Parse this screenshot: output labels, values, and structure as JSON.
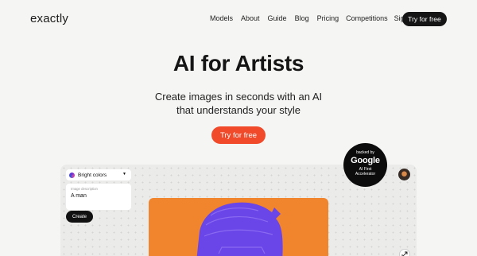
{
  "nav": {
    "logo": "exactly",
    "links": [
      "Models",
      "About",
      "Guide",
      "Blog",
      "Pricing",
      "Competitions",
      "Sign in"
    ],
    "cta": "Try for free"
  },
  "hero": {
    "title": "AI for Artists",
    "subtitle": "Create images in seconds with an AI that understands your style",
    "cta": "Try for free"
  },
  "badge": {
    "line1": "backed by",
    "brand": "Google",
    "line3": "AI First",
    "line4": "Accelerator"
  },
  "demo": {
    "style_select": {
      "value": "Bright colors",
      "icon": "color-swatch-icon",
      "caret": "chevron-down-icon"
    },
    "description": {
      "label": "Image description",
      "value": "A man"
    },
    "create_label": "Create",
    "image_colors": {
      "background": "#f0852d",
      "figure": "#6a45e8"
    }
  },
  "colors": {
    "accent": "#f04a2b",
    "dark": "#151515",
    "page_bg": "#f5f5f3"
  }
}
